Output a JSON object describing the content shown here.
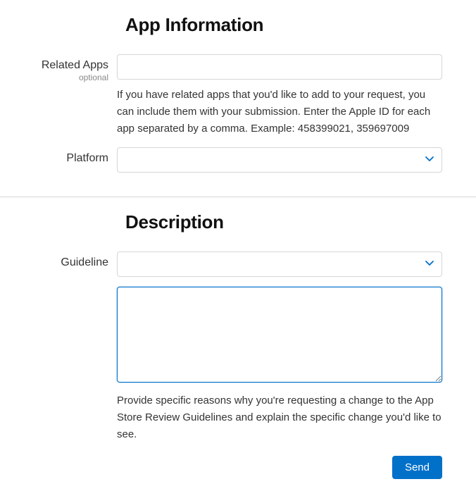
{
  "app_information": {
    "heading": "App Information",
    "related_apps": {
      "label": "Related Apps",
      "sublabel": "optional",
      "value": "",
      "helper": "If you have related apps that you'd like to add to your request, you can include them with your submission. Enter the Apple ID for each app separated by a comma. Example: 458399021, 359697009"
    },
    "platform": {
      "label": "Platform",
      "value": ""
    }
  },
  "description": {
    "heading": "Description",
    "guideline": {
      "label": "Guideline",
      "value": ""
    },
    "reason": {
      "value": "",
      "helper": "Provide specific reasons why you're requesting a change to the App Store Review Guidelines and explain the specific change you'd like to see."
    },
    "send_button": "Send"
  }
}
